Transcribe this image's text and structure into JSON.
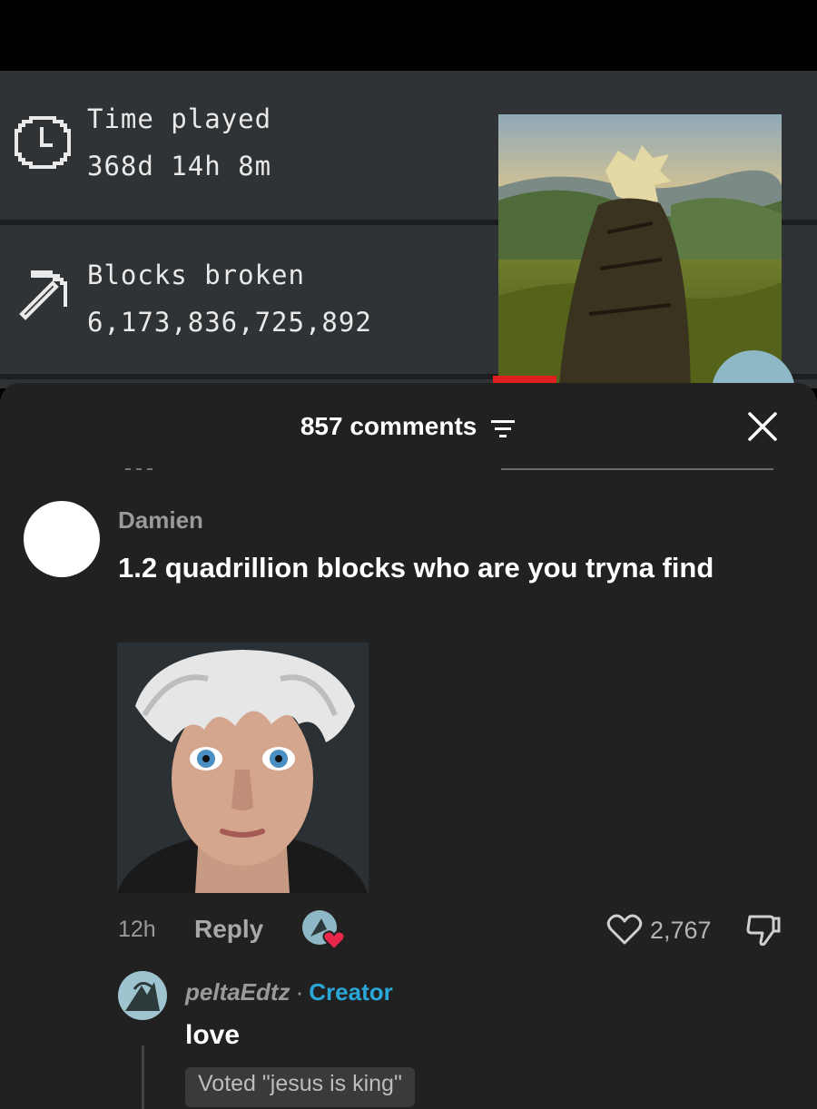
{
  "stats": {
    "time_played": {
      "label": "Time played",
      "value": "368d 14h 8m",
      "icon": "clock-icon"
    },
    "blocks_broken": {
      "label": "Blocks broken",
      "value": "6,173,836,725,892",
      "icon": "pickaxe-icon"
    }
  },
  "sheet": {
    "title": "857 comments",
    "close_icon": "close-icon",
    "filter_icon": "filter-icon"
  },
  "comment": {
    "username": "Damien",
    "text": "1.2 quadrillion blocks who are you tryna find",
    "time": "12h",
    "reply_label": "Reply",
    "like_count": "2,767"
  },
  "reply": {
    "username": "peltaEdtz",
    "separator": "·",
    "badge": "Creator",
    "text": "love",
    "vote_chip": "Voted \"jesus is king\""
  },
  "colors": {
    "sheet_bg": "#212121",
    "creator_blue": "#2aa7d9",
    "stats_bg": "#303335",
    "heart_red": "#e8284a"
  }
}
